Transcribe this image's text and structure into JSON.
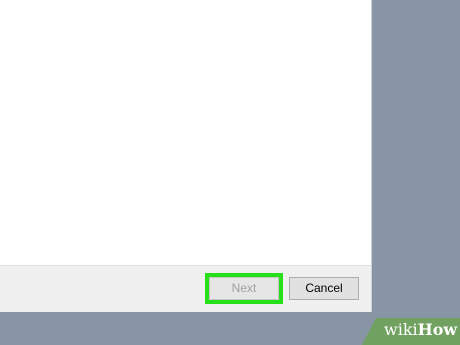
{
  "dialog": {
    "buttons": {
      "next_label": "Next",
      "cancel_label": "Cancel"
    }
  },
  "watermark": {
    "wiki": "wiki",
    "how": "How"
  },
  "colors": {
    "desktop_background": "#8795a5",
    "highlight": "#26e01a",
    "watermark_green": "#6fa25a"
  }
}
